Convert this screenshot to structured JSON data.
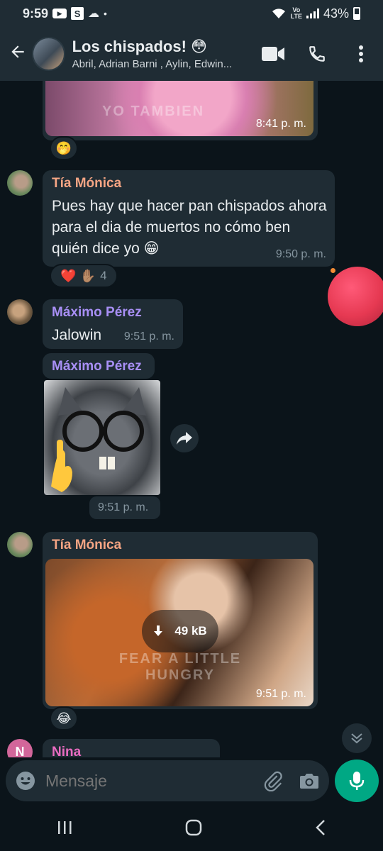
{
  "status_bar": {
    "time": "9:59",
    "lte_top": "Vo",
    "lte_bottom": "LTE",
    "battery": "43%",
    "s_badge": "S"
  },
  "header": {
    "title": "Los chispados! 😳",
    "subtitle": "Abril, Adrian Barni , Aylin, Edwin...",
    "icons": [
      "back-arrow-icon",
      "video-call-icon",
      "phone-icon",
      "more-vert-icon"
    ]
  },
  "messages": [
    {
      "type": "image",
      "time": "8:41 p. m.",
      "image_caption": "YO TAMBIEN",
      "reactions": "🤭"
    },
    {
      "type": "text",
      "sender": "Tía Mónica",
      "sender_color": "#f5a584",
      "text": "Pues hay que hacer pan chispados ahora para el dia de muertos no cómo ben quién dice yo 😁",
      "time": "9:50 p. m.",
      "reactions": "❤️ ✋🏽",
      "reaction_count": "4"
    },
    {
      "type": "text",
      "sender": "Máximo Pérez",
      "sender_color": "#a88ff5",
      "text": "Jalowin",
      "time": "9:51 p. m."
    },
    {
      "type": "sticker",
      "sender": "Máximo Pérez",
      "sender_color": "#a88ff5",
      "time": "9:51 p. m."
    },
    {
      "type": "gif",
      "sender": "Tía Mónica",
      "sender_color": "#f5a584",
      "download_size": "49 kB",
      "image_caption": "FEAR A LITTLE HUNGRY",
      "time": "9:51 p. m.",
      "reactions": "😂"
    },
    {
      "type": "text",
      "sender": "Nina",
      "sender_color": "#e86bc0",
      "avatar_letter": "N"
    }
  ],
  "composer": {
    "placeholder": "Mensaje"
  },
  "colors": {
    "header_bg": "#1f2c34",
    "chat_bg": "#0b141a",
    "bubble_bg": "#1f2c34",
    "accent": "#00a884"
  }
}
